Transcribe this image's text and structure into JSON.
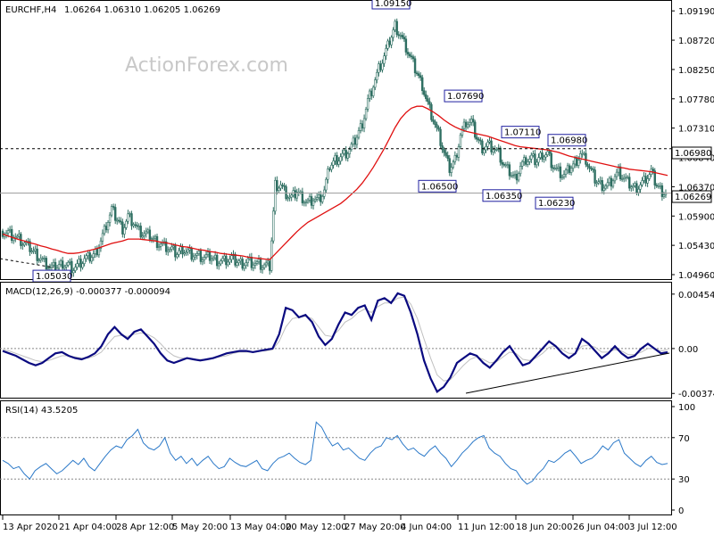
{
  "header": {
    "symbol": "EURCHF,H4",
    "ohlc": "1.06264 1.06310 1.06205 1.06269"
  },
  "watermark": "ActionForex.com",
  "colors": {
    "candle": "#2f6f62",
    "ma": "#e01010",
    "macd": "#0a0a80",
    "signal": "#c0c0c0",
    "rsi": "#2a78c8",
    "frame": "#000000",
    "dotted": "#000000",
    "label_border": "#2020a0"
  },
  "chart_data": [
    {
      "type": "candlestick",
      "name": "price",
      "ylim": [
        1.0496,
        1.0925
      ],
      "y_ticks": [
        "1.09190",
        "1.08720",
        "1.08250",
        "1.07780",
        "1.07310",
        "1.06840",
        "1.06370",
        "1.05900",
        "1.05430",
        "1.04960"
      ],
      "x_ticks": [
        "13 Apr 2020",
        "21 Apr 04:00",
        "28 Apr 12:00",
        "5 May 20:00",
        "13 May 04:00",
        "20 May 12:00",
        "27 May 20:00",
        "4 Jun 04:00",
        "11 Jun 12:00",
        "18 Jun 20:00",
        "26 Jun 04:00",
        "3 Jul 12:00"
      ],
      "resistance_level": {
        "label": "1.06980",
        "value": 1.0698
      },
      "current_price": {
        "label": "1.06269",
        "value": 1.06269
      },
      "annotations": [
        {
          "label": "1.05030",
          "value": 1.0503
        },
        {
          "label": "1.09150",
          "value": 1.0915
        },
        {
          "label": "1.07690",
          "value": 1.0769
        },
        {
          "label": "1.06500",
          "value": 1.065
        },
        {
          "label": "1.07110",
          "value": 1.0711
        },
        {
          "label": "1.06350",
          "value": 1.0635
        },
        {
          "label": "1.06980",
          "value": 1.0698
        },
        {
          "label": "1.06230",
          "value": 1.0623
        }
      ],
      "close_path": [
        1.0566,
        1.0563,
        1.0558,
        1.0552,
        1.0545,
        1.0538,
        1.053,
        1.0522,
        1.0512,
        1.0506,
        1.0508,
        1.0515,
        1.0512,
        1.0506,
        1.0512,
        1.052,
        1.0523,
        1.053,
        1.055,
        1.0575,
        1.06,
        1.0585,
        1.057,
        1.059,
        1.058,
        1.0565,
        1.056,
        1.0558,
        1.055,
        1.0545,
        1.054,
        1.0535,
        1.053,
        1.0538,
        1.0532,
        1.0528,
        1.0525,
        1.0522,
        1.0524,
        1.052,
        1.0518,
        1.0519,
        1.0521,
        1.0517,
        1.0515,
        1.0518,
        1.0515,
        1.0512,
        1.051,
        1.0508,
        1.064,
        1.064,
        1.0625,
        1.0618,
        1.063,
        1.062,
        1.0612,
        1.0618,
        1.0615,
        1.063,
        1.067,
        1.068,
        1.0685,
        1.069,
        1.07,
        1.0718,
        1.074,
        1.0775,
        1.08,
        1.0825,
        1.0845,
        1.087,
        1.0895,
        1.088,
        1.086,
        1.084,
        1.082,
        1.08,
        1.077,
        1.0745,
        1.072,
        1.069,
        1.0665,
        1.068,
        1.072,
        1.074,
        1.074,
        1.0715,
        1.07,
        1.0705,
        1.07,
        1.069,
        1.067,
        1.066,
        1.065,
        1.067,
        1.068,
        1.0682,
        1.0678,
        1.069,
        1.069,
        1.067,
        1.066,
        1.0655,
        1.0665,
        1.0675,
        1.069,
        1.068,
        1.066,
        1.0645,
        1.064,
        1.064,
        1.065,
        1.066,
        1.065,
        1.064,
        1.0635,
        1.064,
        1.065,
        1.066,
        1.064,
        1.063,
        1.0627
      ],
      "ma_path": [
        1.0561,
        1.0558,
        1.0555,
        1.0552,
        1.055,
        1.0547,
        1.0545,
        1.0542,
        1.054,
        1.0537,
        1.0535,
        1.0532,
        1.053,
        1.053,
        1.0531,
        1.0533,
        1.0535,
        1.0537,
        1.054,
        1.0543,
        1.0546,
        1.0548,
        1.055,
        1.0553,
        1.0553,
        1.0553,
        1.0552,
        1.0551,
        1.055,
        1.0548,
        1.0547,
        1.0545,
        1.0543,
        1.0541,
        1.054,
        1.0538,
        1.0536,
        1.0535,
        1.0533,
        1.0532,
        1.053,
        1.0529,
        1.0528,
        1.0527,
        1.0526,
        1.0524,
        1.0523,
        1.0522,
        1.0521,
        1.052,
        1.0529,
        1.0538,
        1.0547,
        1.0556,
        1.0565,
        1.0573,
        1.058,
        1.0585,
        1.059,
        1.0595,
        1.06,
        1.0605,
        1.061,
        1.0617,
        1.0625,
        1.0633,
        1.0643,
        1.0655,
        1.0668,
        1.0683,
        1.0698,
        1.0715,
        1.0732,
        1.0746,
        1.0756,
        1.0763,
        1.0766,
        1.0766,
        1.0762,
        1.0757,
        1.0751,
        1.0744,
        1.0738,
        1.0733,
        1.0729,
        1.0726,
        1.0724,
        1.0722,
        1.072,
        1.0718,
        1.0715,
        1.0712,
        1.0709,
        1.0706,
        1.0703,
        1.0701,
        1.07,
        1.0699,
        1.0698,
        1.0697,
        1.0696,
        1.0694,
        1.0692,
        1.0689,
        1.0686,
        1.0684,
        1.0682,
        1.068,
        1.0678,
        1.0676,
        1.0674,
        1.0672,
        1.067,
        1.0668,
        1.0667,
        1.0665,
        1.0664,
        1.0663,
        1.0662,
        1.0661,
        1.0659,
        1.0657,
        1.0655
      ]
    },
    {
      "type": "line",
      "name": "macd",
      "header": "MACD(12,26,9) -0.000377 -0.000094",
      "ylim": [
        -0.00395,
        0.0049
      ],
      "y_ticks": [
        "0.00454",
        "0.00",
        "-0.003745"
      ],
      "zero_level": 0,
      "macd_path": [
        -0.0002,
        -0.0004,
        -0.0006,
        -0.0009,
        -0.0012,
        -0.0014,
        -0.0012,
        -0.0008,
        -0.0004,
        -0.0003,
        -0.0006,
        -0.0008,
        -0.0009,
        -0.0007,
        -0.0004,
        0.0002,
        0.0012,
        0.0018,
        0.0012,
        0.0008,
        0.0014,
        0.0016,
        0.001,
        0.0004,
        -0.0004,
        -0.001,
        -0.0012,
        -0.001,
        -0.0008,
        -0.0009,
        -0.001,
        -0.0009,
        -0.0008,
        -0.0006,
        -0.0004,
        -0.0003,
        -0.0002,
        -0.0002,
        -0.0003,
        -0.0002,
        -0.0001,
        0.0,
        0.0012,
        0.0034,
        0.0032,
        0.0026,
        0.0028,
        0.0022,
        0.001,
        0.0003,
        0.0008,
        0.002,
        0.003,
        0.0028,
        0.0034,
        0.0036,
        0.0024,
        0.004,
        0.0042,
        0.0038,
        0.0046,
        0.0044,
        0.003,
        0.0012,
        -0.001,
        -0.0025,
        -0.0036,
        -0.0032,
        -0.0024,
        -0.0012,
        -0.0008,
        -0.0004,
        -0.0006,
        -0.0012,
        -0.0016,
        -0.001,
        -0.0003,
        0.0002,
        -0.0006,
        -0.0014,
        -0.0012,
        -0.0006,
        0.0,
        0.0006,
        0.0002,
        -0.0004,
        -0.0008,
        -0.0004,
        0.0008,
        0.0004,
        -0.0002,
        -0.0008,
        -0.0004,
        0.0002,
        -0.0004,
        -0.0008,
        -0.0006,
        0.0,
        0.0004,
        0.0,
        -0.0004,
        -0.0003
      ],
      "signal_path": [
        -0.0001,
        -0.0002,
        -0.0004,
        -0.0006,
        -0.0008,
        -0.001,
        -0.0011,
        -0.001,
        -0.0008,
        -0.0006,
        -0.0006,
        -0.0007,
        -0.0008,
        -0.0008,
        -0.0006,
        -0.0003,
        0.0004,
        0.001,
        0.0011,
        0.001,
        0.0012,
        0.0013,
        0.0012,
        0.0009,
        0.0004,
        -0.0002,
        -0.0006,
        -0.0008,
        -0.0008,
        -0.0009,
        -0.0009,
        -0.0009,
        -0.0008,
        -0.0007,
        -0.0006,
        -0.0004,
        -0.0003,
        -0.0003,
        -0.0003,
        -0.0002,
        -0.0002,
        -0.0001,
        0.0006,
        0.0018,
        0.0025,
        0.0026,
        0.0027,
        0.0025,
        0.0018,
        0.0011,
        0.001,
        0.0015,
        0.0022,
        0.0025,
        0.003,
        0.0033,
        0.003,
        0.0035,
        0.0038,
        0.0038,
        0.0042,
        0.0043,
        0.0037,
        0.0025,
        0.0008,
        -0.0008,
        -0.0022,
        -0.0027,
        -0.0026,
        -0.002,
        -0.0014,
        -0.0009,
        -0.0007,
        -0.0009,
        -0.0012,
        -0.0011,
        -0.0007,
        -0.0003,
        -0.0004,
        -0.0009,
        -0.001,
        -0.0008,
        -0.0004,
        0.0001,
        0.0002,
        -0.0001,
        -0.0004,
        -0.0004,
        0.0002,
        0.0003,
        0.0001,
        -0.0003,
        -0.0003,
        -0.0001,
        -0.0002,
        -0.0005,
        -0.0005,
        -0.0003,
        0.0,
        0.0,
        -0.0002,
        -0.0001
      ]
    },
    {
      "type": "line",
      "name": "rsi",
      "header": "RSI(14) 43.5205",
      "ylim": [
        0,
        100
      ],
      "y_ticks": [
        "100",
        "70",
        "30",
        "0"
      ],
      "levels": [
        70,
        30
      ],
      "values": [
        48,
        45,
        40,
        42,
        35,
        30,
        38,
        42,
        45,
        40,
        35,
        38,
        43,
        48,
        44,
        50,
        42,
        38,
        45,
        52,
        58,
        62,
        60,
        68,
        72,
        78,
        65,
        60,
        58,
        62,
        70,
        55,
        48,
        52,
        45,
        50,
        43,
        48,
        52,
        45,
        40,
        42,
        50,
        46,
        43,
        42,
        45,
        48,
        40,
        38,
        45,
        50,
        52,
        55,
        50,
        46,
        44,
        48,
        85,
        80,
        70,
        62,
        65,
        58,
        60,
        55,
        50,
        48,
        55,
        60,
        62,
        70,
        68,
        72,
        64,
        58,
        60,
        55,
        52,
        58,
        62,
        55,
        50,
        42,
        48,
        55,
        60,
        66,
        70,
        72,
        60,
        55,
        52,
        45,
        40,
        38,
        30,
        25,
        28,
        35,
        40,
        48,
        46,
        50,
        55,
        58,
        52,
        45,
        48,
        50,
        55,
        62,
        58,
        65,
        68,
        55,
        50,
        45,
        42,
        48,
        52,
        46,
        44,
        45
      ]
    }
  ]
}
